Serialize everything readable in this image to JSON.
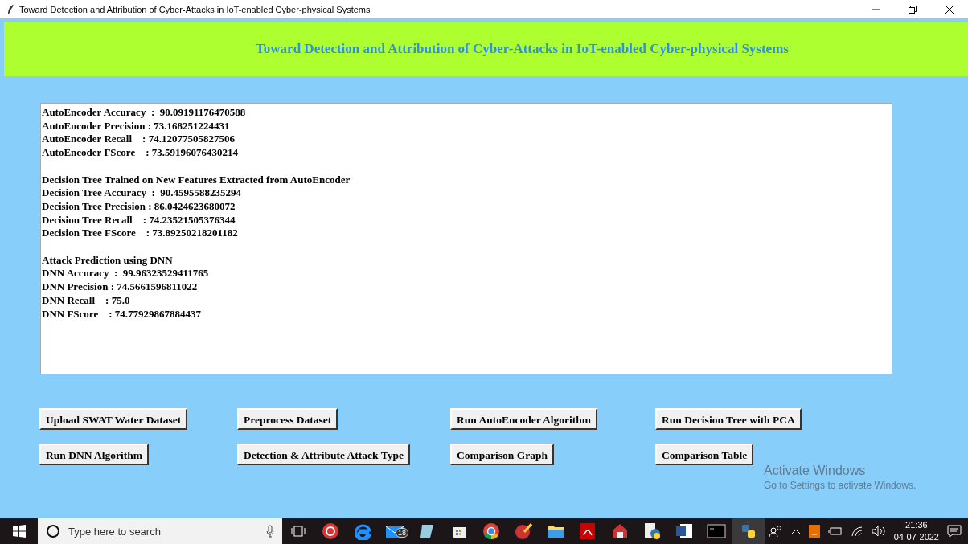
{
  "window": {
    "title": "Toward Detection and Attribution of Cyber-Attacks in IoT-enabled Cyber-physical Systems"
  },
  "header": {
    "title": "Toward Detection and Attribution of Cyber-Attacks in IoT-enabled Cyber-physical Systems"
  },
  "output": [
    {
      "lines": [
        "AutoEncoder Accuracy  :  90.09191176470588",
        "AutoEncoder Precision : 73.168251224431",
        "AutoEncoder Recall    : 74.12077505827506",
        "AutoEncoder FScore    : 73.59196076430214"
      ]
    },
    {
      "lines": [
        "Decision Tree Trained on New Features Extracted from AutoEncoder",
        "Decision Tree Accuracy  :  90.4595588235294",
        "Decision Tree Precision : 86.0424623680072",
        "Decision Tree Recall    : 74.23521505376344",
        "Decision Tree FScore    : 73.89250218201182"
      ]
    },
    {
      "lines": [
        "Attack Prediction using DNN",
        "DNN Accuracy  :  99.96323529411765",
        "DNN Precision : 74.5661596811022",
        "DNN Recall    : 75.0",
        "DNN FScore    : 74.77929867884437"
      ]
    }
  ],
  "buttons": [
    [
      "Upload SWAT Water Dataset",
      "Preprocess Dataset",
      "Run AutoEncoder Algorithm",
      "Run Decision Tree with PCA"
    ],
    [
      "Run DNN Algorithm",
      "Detection & Attribute Attack Type",
      "Comparison Graph",
      "Comparison Table"
    ]
  ],
  "activation": {
    "title": "Activate Windows",
    "hint": "Go to Settings to activate Windows."
  },
  "taskbar": {
    "search": {
      "placeholder": "Type here to search"
    },
    "mail_badge": "18",
    "time": "21:36",
    "date": "04-07-2022"
  }
}
